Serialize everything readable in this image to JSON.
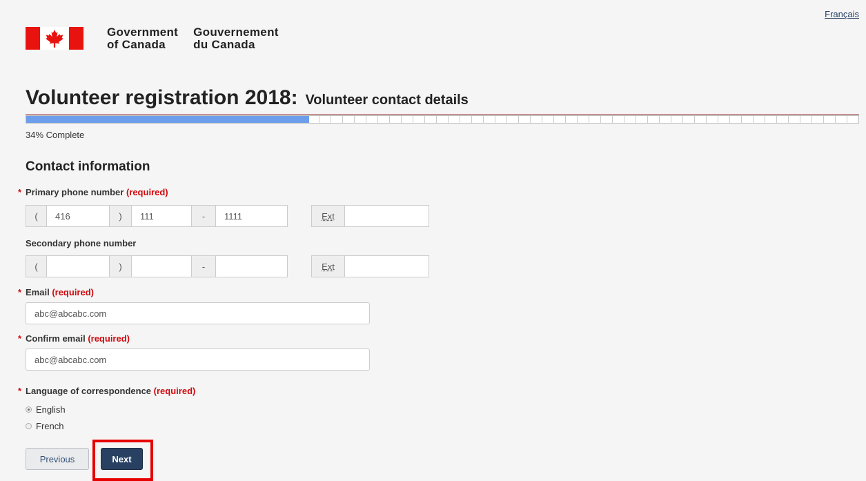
{
  "header": {
    "language_link": "Français",
    "gov_en": "Government\nof Canada",
    "gov_fr": "Gouvernement\ndu Canada",
    "icons": {
      "flag": "canada-flag-icon",
      "maple_leaf": "maple-leaf-icon"
    },
    "colors": {
      "flag_red": "#e8130f",
      "title_rule": "#a84a4e"
    }
  },
  "page": {
    "title": "Volunteer registration 2018:",
    "subtitle": "Volunteer contact details"
  },
  "progress": {
    "value": 0.34,
    "text": "34% Complete",
    "color": "#6d9eeb"
  },
  "form": {
    "section_heading": "Contact information",
    "required_marker": "*",
    "required_text": "(required)",
    "required_color": "#d3080c",
    "primary_phone": {
      "label": "Primary phone number",
      "open_paren": "(",
      "close_paren": ")",
      "dash": "-",
      "ext_label": "Ext",
      "area_code": "416",
      "prefix": "111",
      "line": "1111",
      "ext": ""
    },
    "secondary_phone": {
      "label": "Secondary phone number",
      "open_paren": "(",
      "close_paren": ")",
      "dash": "-",
      "ext_label": "Ext",
      "area_code": "",
      "prefix": "",
      "line": "",
      "ext": ""
    },
    "email": {
      "label": "Email",
      "value": "abc@abcabc.com"
    },
    "confirm_email": {
      "label": "Confirm email",
      "value": "abc@abcabc.com"
    },
    "language": {
      "label": "Language of correspondence",
      "options": [
        {
          "label": "English",
          "checked": true
        },
        {
          "label": "French",
          "checked": false
        }
      ]
    }
  },
  "buttons": {
    "previous": "Previous",
    "next": "Next",
    "next_color": "#284162"
  }
}
